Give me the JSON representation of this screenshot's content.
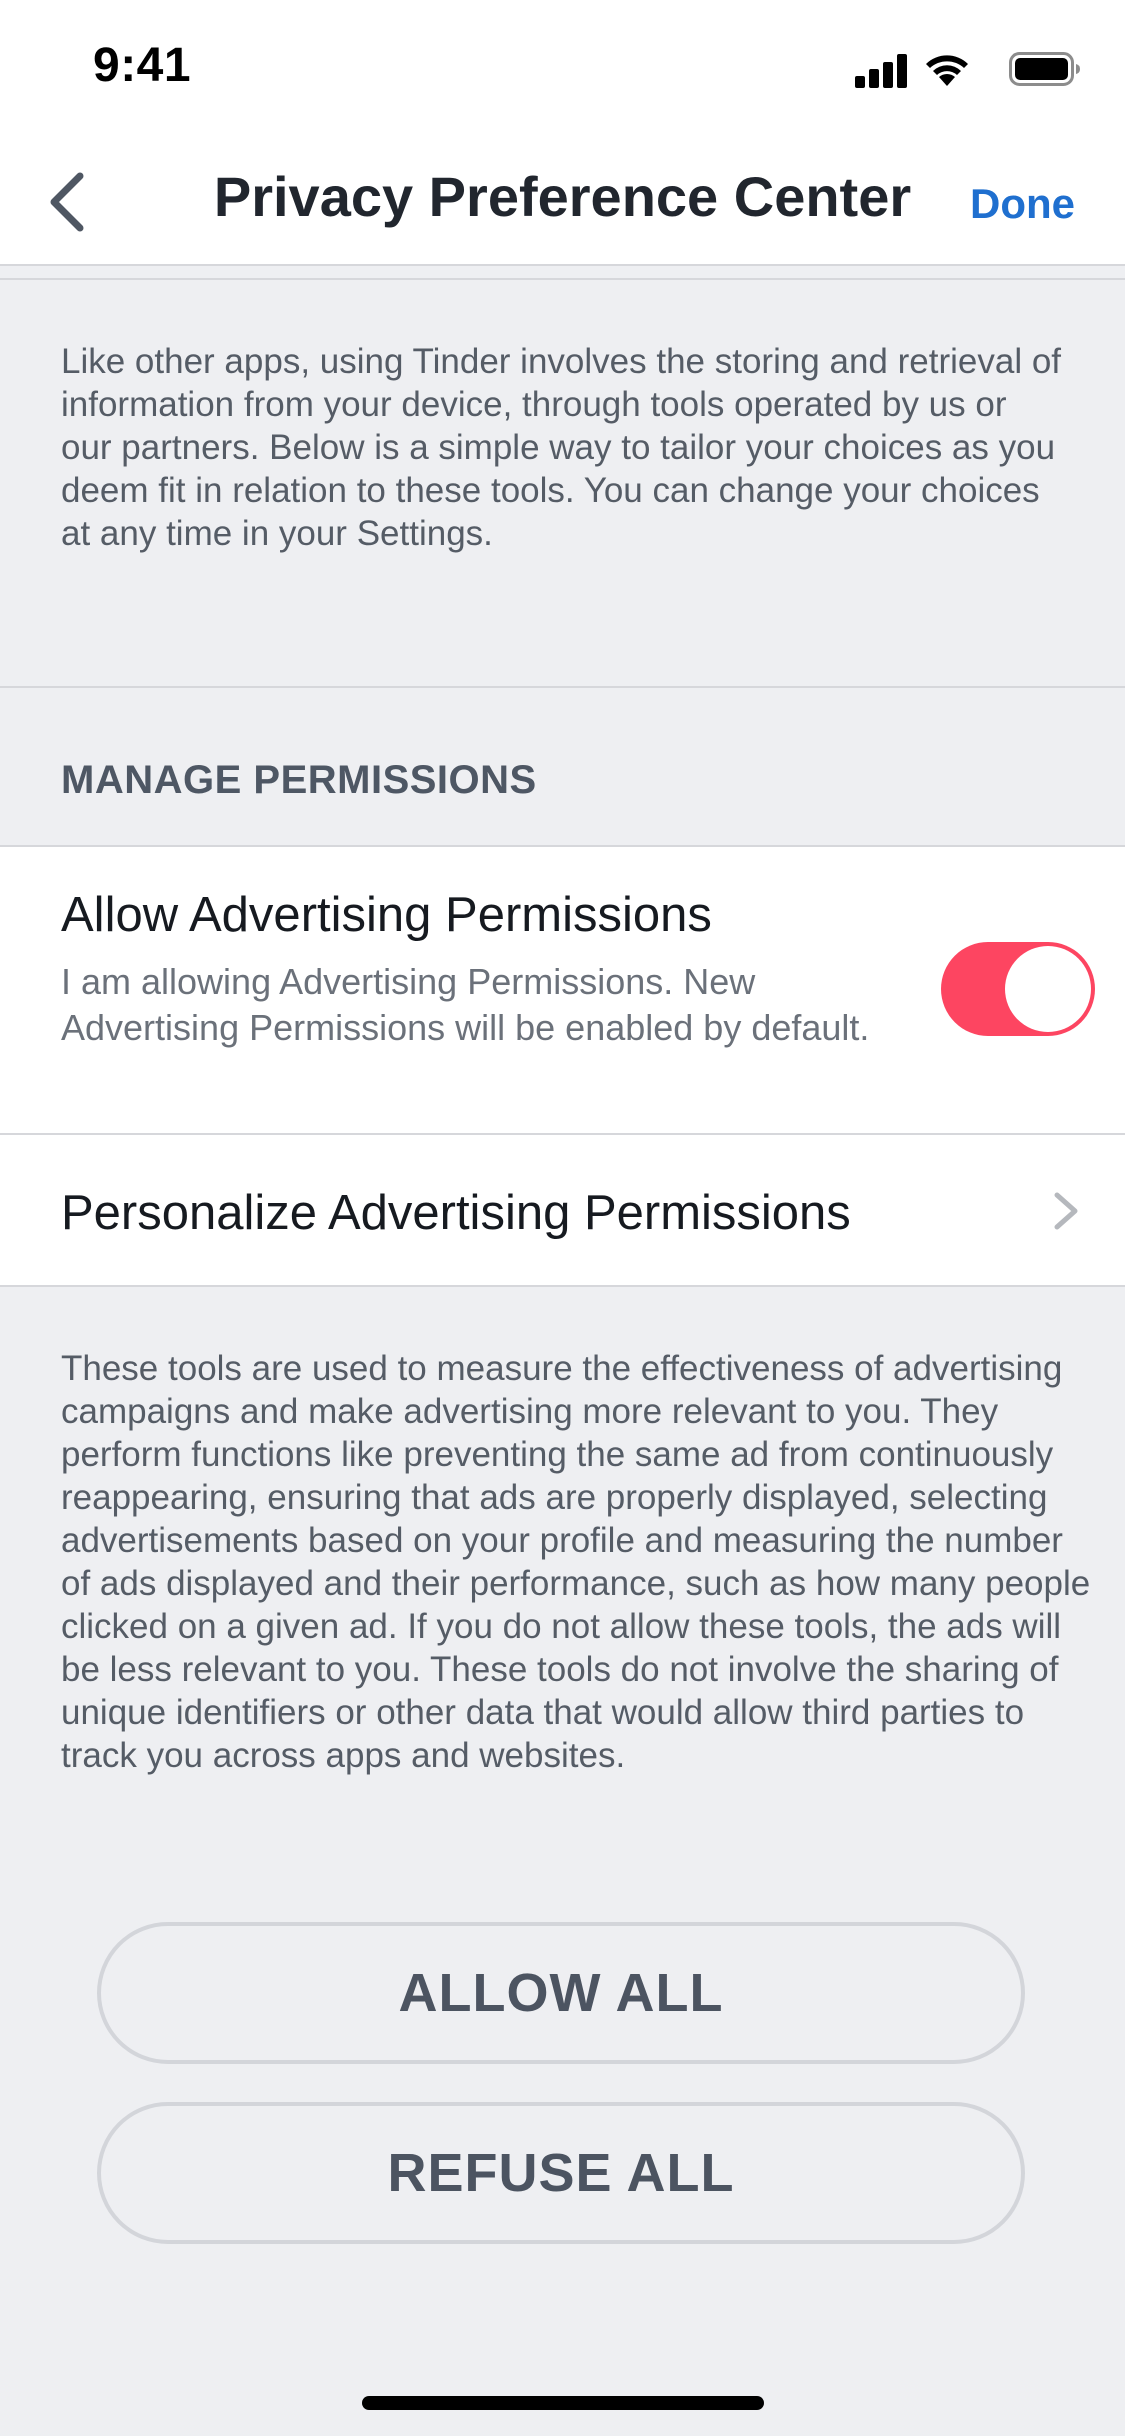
{
  "status_bar": {
    "time": "9:41",
    "icons": [
      "signal-icon",
      "wifi-icon",
      "battery-icon"
    ]
  },
  "nav": {
    "back_icon": "chevron-left-icon",
    "title": "Privacy Preference Center",
    "done_label": "Done"
  },
  "intro": {
    "text": "Like other apps, using Tinder involves the storing and retrieval of information from your device, through tools operated by us or our partners. Below is a simple way to tailor your choices as you deem fit in relation to these tools. You can change your choices at any time in your Settings."
  },
  "manage_permissions": {
    "header": "MANAGE PERMISSIONS",
    "advertising": {
      "title": "Allow Advertising Permissions",
      "description": "I am allowing Advertising Permissions. New Advertising Permissions will be enabled by default.",
      "toggle_on": true
    },
    "personalize": {
      "label": "Personalize Advertising Permissions",
      "icon": "chevron-right-icon"
    }
  },
  "details": {
    "text": "These tools are used to measure the effectiveness of advertising campaigns and make advertising more relevant to you. They perform functions like preventing the same ad from continuously reappearing, ensuring that ads are properly displayed, selecting advertisements based on your profile and measuring the number of ads displayed and their performance, such as how many people clicked on a given ad. If you do not allow these tools, the ads will be less relevant to you. These tools do not involve the sharing of unique identifiers or other data that would allow third parties to track you across apps and websites."
  },
  "actions": {
    "allow_all_label": "ALLOW ALL",
    "refuse_all_label": "REFUSE ALL"
  },
  "colors": {
    "accent_blue": "#1f6fcf",
    "toggle_on": "#fd4561",
    "background": "#eeeff2"
  }
}
